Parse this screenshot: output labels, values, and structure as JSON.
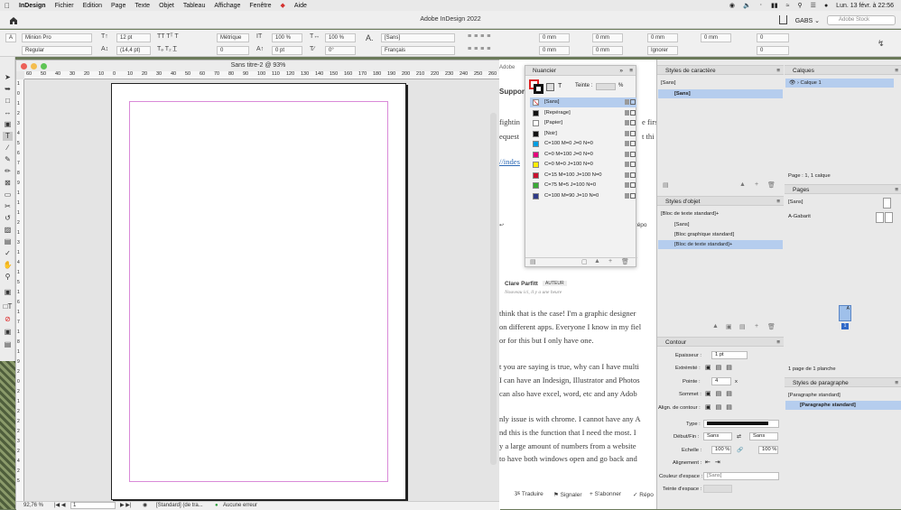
{
  "menubar": {
    "app": "InDesign",
    "items": [
      "Fichier",
      "Edition",
      "Page",
      "Texte",
      "Objet",
      "Tableau",
      "Affichage",
      "Fenêtre",
      "Aide"
    ],
    "clock": "Lun. 13 févr. à 22:56"
  },
  "app": {
    "title": "Adobe InDesign 2022",
    "workspace": "GABS",
    "stock_placeholder": "Adobe Stock"
  },
  "control": {
    "font": "Minion Pro",
    "style": "Regular",
    "size": "12 pt",
    "leading": "(14,4 pt)",
    "kerning": "Métrique",
    "tracking": "0",
    "vscale": "100 %",
    "hscale": "100 %",
    "baseline": "0 pt",
    "skew": "0°",
    "charstyle": "[Sans]",
    "language": "Français",
    "indent1": "0 mm",
    "indent2": "0 mm",
    "indent3": "0 mm",
    "indent4": "0 mm",
    "indent5": "0 mm",
    "indent6": "0 mm",
    "drop1": "0",
    "drop2": "0",
    "ignore": "Ignorer"
  },
  "document": {
    "title": "Sans titre-2 @ 93%",
    "hruler": [
      "60",
      "50",
      "40",
      "30",
      "20",
      "10",
      "0",
      "10",
      "20",
      "30",
      "40",
      "50",
      "60",
      "70",
      "80",
      "90",
      "100",
      "110",
      "120",
      "130",
      "140",
      "150",
      "160",
      "170",
      "180",
      "190",
      "200",
      "210",
      "220",
      "230",
      "240",
      "250",
      "260"
    ],
    "vruler": [
      "1",
      "0",
      "1",
      "2",
      "3",
      "4",
      "5",
      "6",
      "7",
      "8",
      "9",
      "1",
      "1",
      "1",
      "2",
      "1",
      "3",
      "1",
      "4",
      "1",
      "5",
      "1",
      "6",
      "1",
      "7",
      "1",
      "8",
      "1",
      "9",
      "2",
      "0",
      "2",
      "1",
      "2",
      "2",
      "2",
      "3",
      "2",
      "4",
      "2",
      "5"
    ],
    "zoom": "92,76 %",
    "page_num": "1",
    "style": "[Standard] (de tra...",
    "errors": "Aucune erreur"
  },
  "web": {
    "tab": "Adobe",
    "heading": "Support",
    "line1": "fightin",
    "line2": "equest",
    "link": "//indes",
    "reply": "Répo",
    "author": "Clare Parfitt",
    "author_badge": "AUTEUR",
    "time": "Nouveau ici, il y a une heure",
    "p1": "think that is the case! I'm a graphic designer",
    "p2": "on different apps. Everyone I know in my fiel",
    "p3": "or for this but I only have one.",
    "p4": "t you are saying is true, why can I have multi",
    "p5": "I can have an Indesign, Illustrator and Photos",
    "p6": "can also have excel, word, etc and any Adob",
    "p7": "nly issue is with chrome. I cannot have any A",
    "p8": "nd this is the function that I need the most. I",
    "p9": "y a large amount of numbers from a website",
    "p10": "to have both windows open and go back and",
    "translate": "Traduire",
    "report": "Signaler",
    "subscribe": "S'abonner",
    "reply2": "Répo",
    "right1": "e first",
    "right2": "t thi"
  },
  "swatches": {
    "title": "Nuancier",
    "tint_label": "Teinte :",
    "tint_unit": "%",
    "items": [
      {
        "name": "[Sans]",
        "color": "#ffffff",
        "selected": true
      },
      {
        "name": "[Repérage]",
        "color": "#111111"
      },
      {
        "name": "[Papier]",
        "color": "#ffffff"
      },
      {
        "name": "[Noir]",
        "color": "#111111"
      },
      {
        "name": "C=100 M=0 J=0 N=0",
        "color": "#009fe3"
      },
      {
        "name": "C=0 M=100 J=0 N=0",
        "color": "#e4007c"
      },
      {
        "name": "C=0 M=0 J=100 N=0",
        "color": "#ffed00"
      },
      {
        "name": "C=15 M=100 J=100 N=0",
        "color": "#c8102e"
      },
      {
        "name": "C=75 M=5 J=100 N=0",
        "color": "#3aaa35"
      },
      {
        "name": "C=100 M=90 J=10 N=0",
        "color": "#2e3a87"
      }
    ]
  },
  "charstyles": {
    "title": "Styles de caractère",
    "current": "[Sans]",
    "items": [
      "[Sans]"
    ]
  },
  "objstyles": {
    "title": "Styles d'objet",
    "current": "[Bloc de texte standard]+",
    "items": [
      "[Sans]",
      "[Bloc graphique standard]",
      "[Bloc de texte standard]+"
    ]
  },
  "stroke": {
    "title": "Contour",
    "weight_label": "Epaisseur :",
    "weight": "1 pt",
    "cap_label": "Extrémité :",
    "miter_label": "Pointe :",
    "miter": "4",
    "miter_unit": "x",
    "join_label": "Sommet :",
    "align_label": "Align. de contour :",
    "type_label": "Type :",
    "startend_label": "Début/Fin :",
    "start": "Sans",
    "end": "Sans",
    "scale_label": "Echelle :",
    "scale1": "100 %",
    "scale2": "100 %",
    "alignment_label": "Alignement :",
    "gapcolor_label": "Couleur d'espace :",
    "gapcolor": "[Sans]",
    "gaptint_label": "Teinte d'espace :"
  },
  "layers": {
    "title": "Calques",
    "layer": "Calque 1",
    "footer": "Page : 1, 1 calque"
  },
  "pages": {
    "title": "Pages",
    "none": "[Sans]",
    "master": "A-Gabarit",
    "master_letter": "A",
    "page_number": "1",
    "footer": "1 page de 1 planche"
  },
  "parastyles": {
    "title": "Styles de paragraphe",
    "current": "[Paragraphe standard]",
    "items": [
      "[Paragraphe standard]"
    ]
  }
}
